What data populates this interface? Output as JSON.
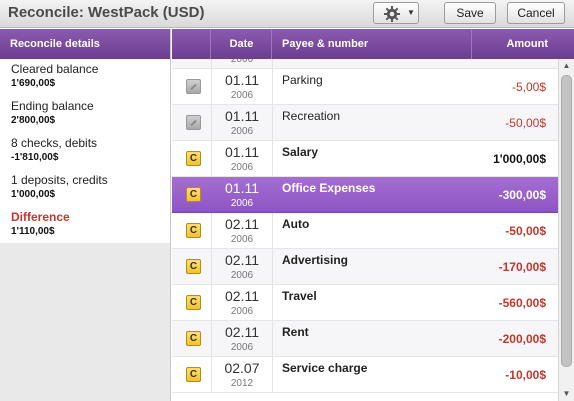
{
  "window": {
    "title": "Reconcile: WestPack (USD)"
  },
  "toolbar": {
    "save_label": "Save",
    "cancel_label": "Cancel",
    "settings_icon": "gear-icon"
  },
  "left_panel": {
    "header": "Reconcile details",
    "items": [
      {
        "label": "Cleared balance",
        "value": "1'690,00$"
      },
      {
        "label": "Ending balance",
        "value": "2'800,00$"
      },
      {
        "label": "8 checks, debits",
        "value": "-1'810,00$"
      },
      {
        "label": "1 deposits, credits",
        "value": "1'000,00$"
      },
      {
        "label": "Difference",
        "value": "1'110,00$"
      }
    ]
  },
  "table": {
    "columns": [
      "Date",
      "Payee & number",
      "Amount"
    ],
    "partial_top_year": "2006",
    "rows": [
      {
        "status": "",
        "day": "01.11",
        "year": "2006",
        "payee": "Parking",
        "amount": "-5,00$"
      },
      {
        "status": "",
        "day": "01.11",
        "year": "2006",
        "payee": "Recreation",
        "amount": "-50,00$"
      },
      {
        "status": "C",
        "day": "01.11",
        "year": "2006",
        "payee": "Salary",
        "amount": "1'000,00$"
      },
      {
        "status": "C",
        "day": "01.11",
        "year": "2006",
        "payee": "Office Expenses",
        "amount": "-300,00$"
      },
      {
        "status": "C",
        "day": "02.11",
        "year": "2006",
        "payee": "Auto",
        "amount": "-50,00$"
      },
      {
        "status": "C",
        "day": "02.11",
        "year": "2006",
        "payee": "Advertising",
        "amount": "-170,00$"
      },
      {
        "status": "C",
        "day": "02.11",
        "year": "2006",
        "payee": "Travel",
        "amount": "-560,00$"
      },
      {
        "status": "C",
        "day": "02.11",
        "year": "2006",
        "payee": "Rent",
        "amount": "-200,00$"
      },
      {
        "status": "C",
        "day": "02.07",
        "year": "2012",
        "payee": "Service charge",
        "amount": "-10,00$"
      }
    ]
  },
  "colors": {
    "accent": "#7b4aa3",
    "selected_row": "#9a62cc",
    "negative": "#c0392b"
  }
}
